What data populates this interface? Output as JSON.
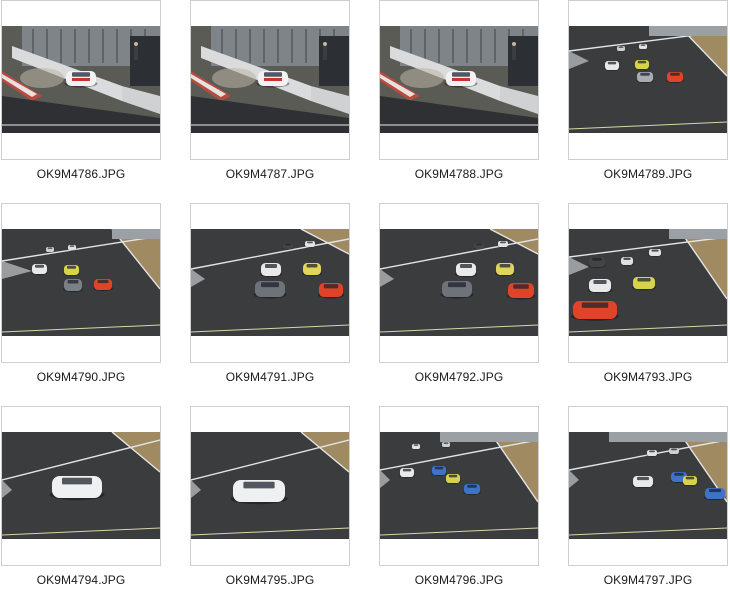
{
  "gallery": {
    "items": [
      {
        "filename": "OK9M4786.JPG",
        "scene": "crash-wall"
      },
      {
        "filename": "OK9M4787.JPG",
        "scene": "crash-wall"
      },
      {
        "filename": "OK9M4788.JPG",
        "scene": "crash-wall"
      },
      {
        "filename": "OK9M4789.JPG",
        "scene": "pack-far"
      },
      {
        "filename": "OK9M4790.JPG",
        "scene": "pack-mid"
      },
      {
        "filename": "OK9M4791.JPG",
        "scene": "pack-close"
      },
      {
        "filename": "OK9M4792.JPG",
        "scene": "pack-close"
      },
      {
        "filename": "OK9M4793.JPG",
        "scene": "pack-red-lead"
      },
      {
        "filename": "OK9M4794.JPG",
        "scene": "single-car"
      },
      {
        "filename": "OK9M4795.JPG",
        "scene": "single-car"
      },
      {
        "filename": "OK9M4796.JPG",
        "scene": "pack-wide"
      },
      {
        "filename": "OK9M4797.JPG",
        "scene": "pack-wide"
      }
    ]
  },
  "colors": {
    "asphalt": "#3a3c3e",
    "grass": "#a08a62",
    "wall": "#9aa0a4",
    "frame_border": "#cfcfcf"
  }
}
